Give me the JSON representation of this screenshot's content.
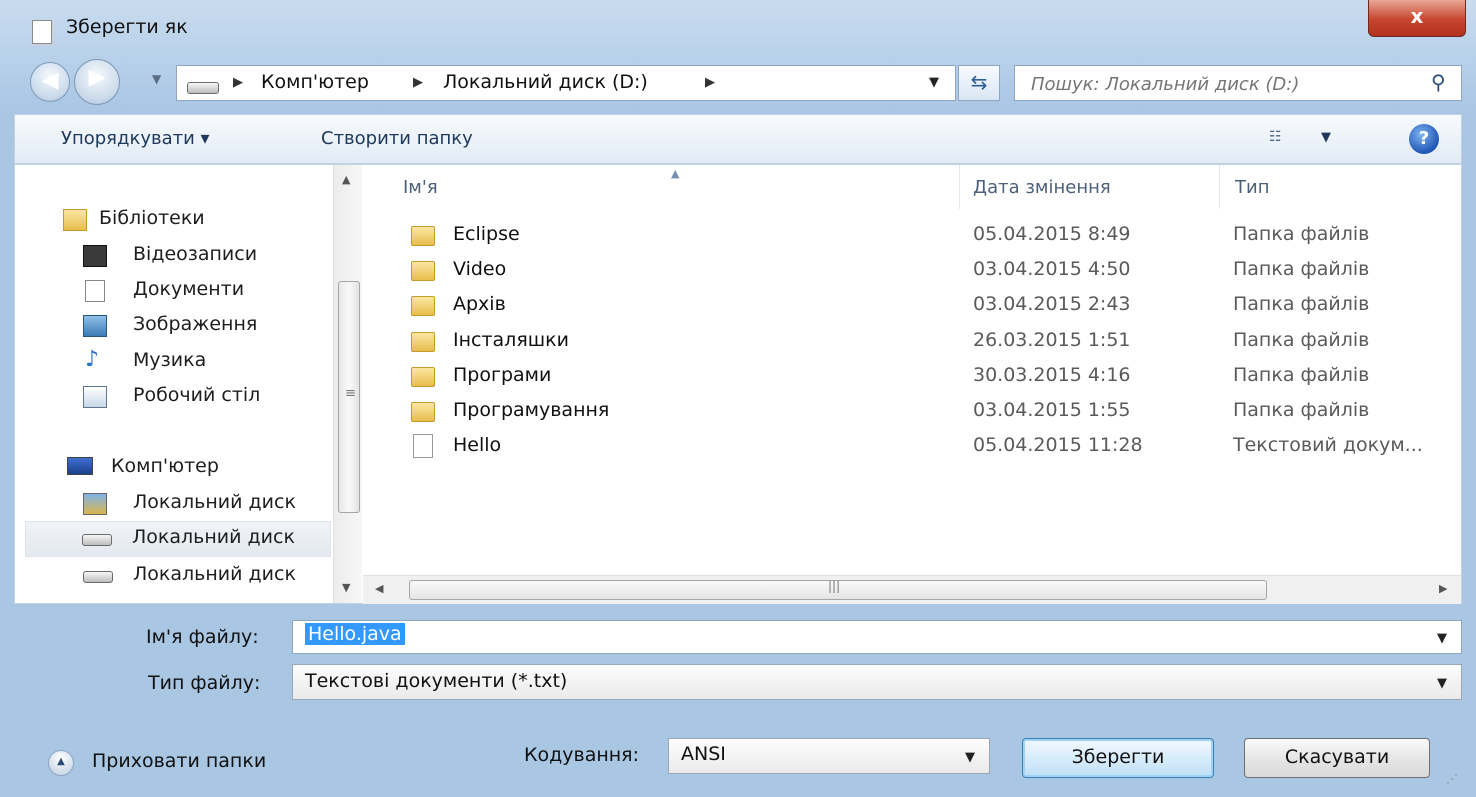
{
  "window": {
    "title": "Зберегти як",
    "close_label": "x"
  },
  "address": {
    "segments": [
      "Комп'ютер",
      "Локальний диск (D:)"
    ],
    "search_placeholder": "Пошук: Локальний диск (D:)"
  },
  "toolbar": {
    "organize_label": "Упорядкувати ▾",
    "new_folder_label": "Створити папку",
    "help_label": "?"
  },
  "nav": {
    "items": [
      {
        "label": "Бібліотеки",
        "icon": "library-icon"
      },
      {
        "label": "Відеозаписи",
        "icon": "video-icon"
      },
      {
        "label": "Документи",
        "icon": "documents-icon"
      },
      {
        "label": "Зображення",
        "icon": "pictures-icon"
      },
      {
        "label": "Музика",
        "icon": "music-icon"
      },
      {
        "label": "Робочий стіл",
        "icon": "desktop-icon"
      },
      {
        "label": "Комп'ютер",
        "icon": "computer-icon"
      },
      {
        "label": "Локальний диск",
        "icon": "system-drive-icon"
      },
      {
        "label": "Локальний диск",
        "icon": "drive-icon"
      },
      {
        "label": "Локальний диск",
        "icon": "drive-icon"
      }
    ],
    "selected_index": 8
  },
  "files": {
    "columns": {
      "name": "Ім'я",
      "date": "Дата змінення",
      "type": "Тип"
    },
    "rows": [
      {
        "name": "Eclipse",
        "date": "05.04.2015 8:49",
        "type": "Папка файлів",
        "icon": "folder-icon"
      },
      {
        "name": "Video",
        "date": "03.04.2015 4:50",
        "type": "Папка файлів",
        "icon": "folder-icon"
      },
      {
        "name": "Архів",
        "date": "03.04.2015 2:43",
        "type": "Папка файлів",
        "icon": "folder-icon"
      },
      {
        "name": "Інсталяшки",
        "date": "26.03.2015 1:51",
        "type": "Папка файлів",
        "icon": "folder-icon"
      },
      {
        "name": "Програми",
        "date": "30.03.2015 4:16",
        "type": "Папка файлів",
        "icon": "folder-icon"
      },
      {
        "name": "Програмування",
        "date": "03.04.2015 1:55",
        "type": "Папка файлів",
        "icon": "folder-icon"
      },
      {
        "name": "Hello",
        "date": "05.04.2015 11:28",
        "type": "Текстовий докум...",
        "icon": "text-file-icon"
      }
    ]
  },
  "form": {
    "filename_label": "Ім'я файлу:",
    "filename_value": "Hello.java",
    "filetype_label": "Тип файлу:",
    "filetype_value": "Текстові документи (*.txt)",
    "hide_folders_label": "Приховати папки",
    "encoding_label": "Кодування:",
    "encoding_value": "ANSI",
    "save_label": "Зберегти",
    "cancel_label": "Скасувати"
  },
  "colors": {
    "selection": "#3399ff",
    "frame": "#a9c6e3",
    "close_button": "#c7452d"
  }
}
